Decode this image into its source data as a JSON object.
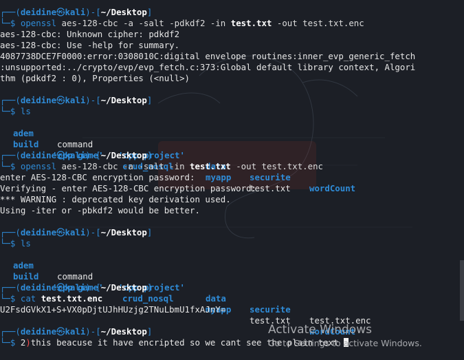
{
  "prompt": {
    "user": "deidine",
    "host": "kali",
    "path": "~/Desktop",
    "at_icon": "kali-at-icon",
    "symbol": "$"
  },
  "blocks": [
    {
      "command": "openssl",
      "args": [
        "aes-128-cbc -a -salt -pdkdf2 -in ",
        "test.txt",
        " -out test.txt.enc"
      ],
      "output": [
        "aes-128-cbc: Unknown cipher: pdkdf2",
        "aes-128-cbc: Use -help for summary.",
        "4087738DCE7F0000:error:0308010C:digital envelope routines:inner_evp_generic_fetch",
        ":unsupported:../crypto/evp/evp_fetch.c:373:Global default library context, Algori",
        "thm (pdkdf2 : 0), Properties (<null>)"
      ]
    },
    {
      "command": "ls",
      "listing": [
        [
          "adem",
          "command",
          "'cpp project'",
          "data",
          "securite",
          "wordCount"
        ],
        [
          "build",
          "'cpp game'",
          "crud_nosql",
          "myapp",
          "test.txt",
          ""
        ]
      ]
    },
    {
      "command": "openssl",
      "args": [
        "aes-128-cbc -a -salt -in ",
        "test.txt",
        " -out test.txt.enc"
      ],
      "output": [
        "enter AES-128-CBC encryption password:",
        "Verifying - enter AES-128-CBC encryption password:",
        "*** WARNING : deprecated key derivation used.",
        "Using -iter or -pbkdf2 would be better."
      ]
    },
    {
      "command": "ls",
      "listing": [
        [
          "adem",
          "command",
          "'cpp project'",
          "data",
          "securite",
          "test.txt.enc"
        ],
        [
          "build",
          "'cpp game'",
          "crud_nosql",
          "myapp",
          "test.txt",
          "wordCount"
        ]
      ]
    },
    {
      "command": "cat",
      "args": [
        "",
        "test.txt.enc",
        ""
      ],
      "output": [
        "U2FsdGVkX1+S+VX0pDjtUJhHUzjg2TNuLbmU1fxAJnY="
      ]
    },
    {
      "command": "2",
      "err_char": ")",
      "rest": "this beacuse it have encripted so we cant see the plain text "
    }
  ],
  "watermark": {
    "title": "Activate Windows",
    "subtitle": "Go to Settings to activate Windows."
  },
  "colors": {
    "background": "#1c1f26",
    "prompt_blue": "#2f8cd8",
    "text": "#e6e6e6",
    "error_red": "#ff4d4d"
  }
}
